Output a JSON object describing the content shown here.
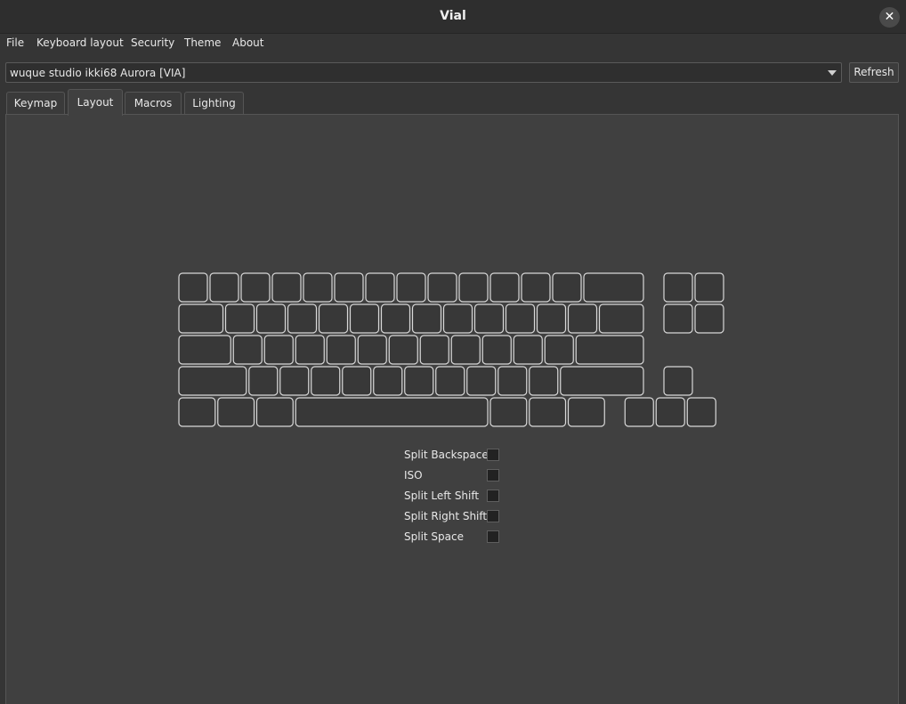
{
  "window": {
    "title": "Vial",
    "close_glyph": "✕"
  },
  "menu": {
    "items": [
      "File",
      "Keyboard layout",
      "Security",
      "Theme",
      "About"
    ]
  },
  "device": {
    "selected": "wuque studio ikki68 Aurora [VIA]"
  },
  "toolbar": {
    "refresh_label": "Refresh"
  },
  "tabs": [
    {
      "label": "Keymap",
      "active": false
    },
    {
      "label": "Layout",
      "active": true
    },
    {
      "label": "Macros",
      "active": false
    },
    {
      "label": "Lighting",
      "active": false
    }
  ],
  "keyboard": {
    "rows": [
      [
        1,
        1,
        1,
        1,
        1,
        1,
        1,
        1,
        1,
        1,
        1,
        1,
        1,
        2,
        "gap",
        1,
        1
      ],
      [
        1.5,
        1,
        1,
        1,
        1,
        1,
        1,
        1,
        1,
        1,
        1,
        1,
        1,
        1.5,
        "gap",
        1,
        1
      ],
      [
        1.75,
        1,
        1,
        1,
        1,
        1,
        1,
        1,
        1,
        1,
        1,
        1,
        2.25
      ],
      [
        2.25,
        1,
        1,
        1,
        1,
        1,
        1,
        1,
        1,
        1,
        1,
        2.75,
        "gap",
        1
      ],
      [
        1.25,
        1.25,
        1.25,
        6.25,
        1.25,
        1.25,
        1.25,
        "gap",
        1,
        1,
        1
      ]
    ]
  },
  "layout_options": [
    {
      "label": "Split Backspace",
      "checked": false
    },
    {
      "label": "ISO",
      "checked": false
    },
    {
      "label": "Split Left Shift",
      "checked": false
    },
    {
      "label": "Split Right Shift",
      "checked": false
    },
    {
      "label": "Split Space",
      "checked": false
    }
  ],
  "colors": {
    "key_fill": "#383838",
    "key_stroke": "#d8d8d8",
    "panel": "#404040"
  }
}
